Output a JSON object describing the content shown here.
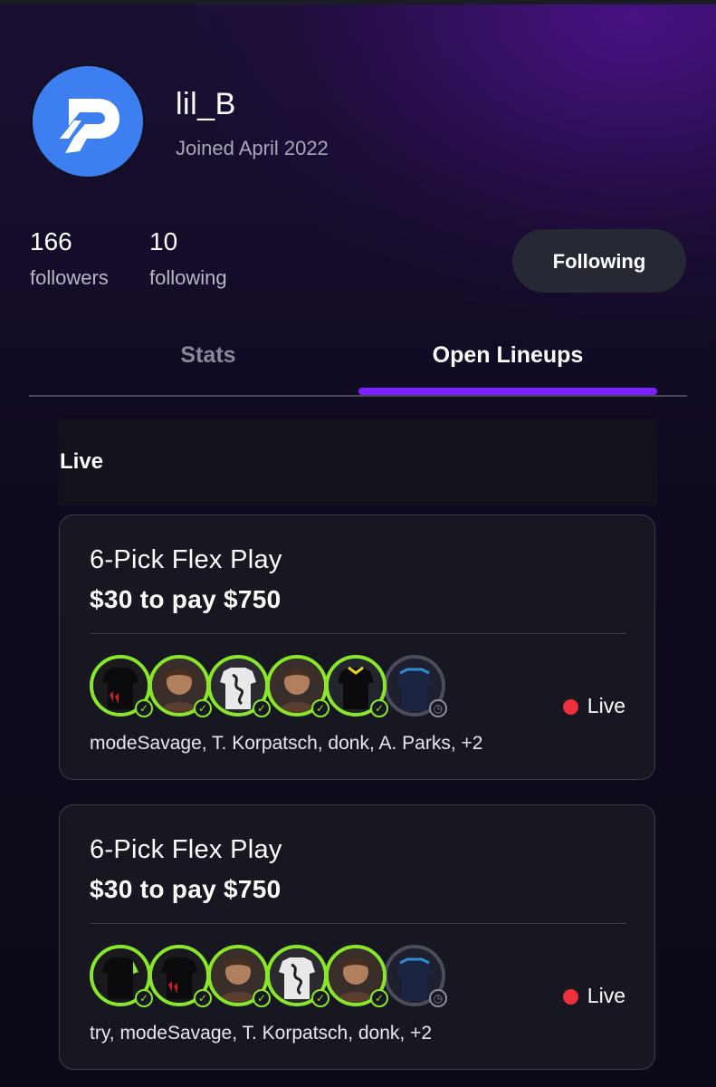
{
  "profile": {
    "username": "lil_B",
    "joined": "Joined April 2022",
    "avatar_icon": "logo-p-icon",
    "avatar_color": "#3d7ff0"
  },
  "stats": {
    "followers_count": "166",
    "followers_label": "followers",
    "following_count": "10",
    "following_label": "following"
  },
  "follow_button": {
    "label": "Following"
  },
  "tabs": [
    {
      "label": "Stats",
      "active": false
    },
    {
      "label": "Open Lineups",
      "active": true
    }
  ],
  "accent_color": "#7b22ff",
  "live_section": {
    "title": "Live"
  },
  "lineups": [
    {
      "title": "6-Pick Flex Play",
      "payout": "$30 to pay $750",
      "status": "Live",
      "players": "modeSavage, T. Korpatsch, donk, A. Parks, +2",
      "picks": [
        {
          "icon": "black-red-jersey-icon",
          "state": "hit"
        },
        {
          "icon": "player-headshot-icon",
          "state": "hit"
        },
        {
          "icon": "white-dragon-jersey-icon",
          "state": "hit"
        },
        {
          "icon": "player-headshot-icon",
          "state": "hit"
        },
        {
          "icon": "black-yellow-jersey-icon",
          "state": "hit"
        },
        {
          "icon": "navy-blue-jersey-icon",
          "state": "pending"
        }
      ]
    },
    {
      "title": "6-Pick Flex Play",
      "payout": "$30 to pay $750",
      "status": "Live",
      "players": "try, modeSavage, T. Korpatsch, donk, +2",
      "picks": [
        {
          "icon": "black-green-jersey-icon",
          "state": "hit"
        },
        {
          "icon": "black-red-jersey-icon",
          "state": "hit"
        },
        {
          "icon": "player-headshot-icon",
          "state": "hit"
        },
        {
          "icon": "white-dragon-jersey-icon",
          "state": "hit"
        },
        {
          "icon": "player-headshot-icon",
          "state": "hit"
        },
        {
          "icon": "navy-blue-jersey-icon",
          "state": "pending"
        }
      ]
    }
  ],
  "colors": {
    "hit": "#8ae62a",
    "pending": "#4b4d5a",
    "live_dot": "#ee2f3c"
  }
}
